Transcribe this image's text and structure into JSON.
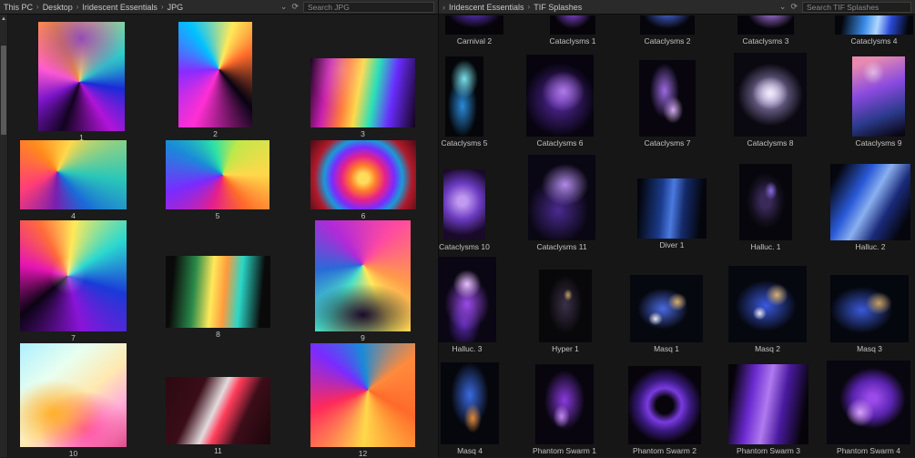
{
  "ui": {
    "crumb_sep": "›",
    "lead_chevron": "›",
    "chevron_down": "⌄",
    "refresh": "⟳",
    "scroll_up": "▲"
  },
  "left_panel": {
    "breadcrumb": [
      "This PC",
      "Desktop",
      "Iridescent Essentials",
      "JPG"
    ],
    "search_placeholder": "Search JPG",
    "items": [
      {
        "label": "1",
        "style": "background-color:#0b0414;background-image:radial-gradient(90% 70% at 50% 15%,rgba(120,40,200,0.8),rgba(0,0,0,0) 60%),conic-gradient(from 200deg at 48% 55%,#12031f,#7a14c8 12%,#ff5ad2 25%,#ff9a2a 38%,#ffe36a 46%,#2ad8c8 60%,#1a2bd8 72%,#b014d8 85%,#12031f)"
      },
      {
        "label": "2",
        "style": "background-color:#070312;background-image:conic-gradient(from 140deg at 55% 45%,#070312,#ff2fd2 18%,#8a2bff 35%,#00c2ff 52%,#ffe95a 66%,#ff6a2a 78%,#070312)"
      },
      {
        "label": "3",
        "style": "background-color:#140318;background-image:radial-gradient(60% 120% at 30% 15%,rgba(255,255,255,0.22),rgba(0,0,0,0) 50%),linear-gradient(100deg,#1a0420,#c81fae 18%,#ff7a3c 34%,#ffd84a 46%,#2ae0b8 60%,#6a2bff 76%,#140318)"
      },
      {
        "label": "4",
        "style": "background-color:#200408;background-image:conic-gradient(from 320deg at 35% 45%,#ff8a1c,#ffd84a 18%,#2ac8b8 38%,#1a6ad8 50%,#7a1fae 62%,#ff3c78 78%,#ff8a1c)"
      },
      {
        "label": "5",
        "style": "background-color:#101010;background-image:conic-gradient(from 90deg at 55% 50%,#ffd84a,#ff6a2a 15%,#e51f8c 30%,#7a2bff 45%,#1a8ad8 58%,#2ae0a8 70%,#bfe84a 82%,#ffd84a)"
      },
      {
        "label": "6",
        "style": "background-color:#1a040a;background-image:radial-gradient(circle at 50% 55%,#ffdc5a 8%,#ff7a2a 20%,#e5208c 34%,#7a2bff 48%,#1a9ad8 60%,#b01a2a 75%,#4a0a14 100%)"
      },
      {
        "label": "7",
        "style": "background-color:#0c0314;background-image:radial-gradient(28% 28% at 45% 50%,rgba(255,255,255,0.3),rgba(0,0,0,0) 60%),conic-gradient(from 230deg at 45% 50%,#0c0314,#e514b4 15%,#ff6a3c 28%,#ffe95a 38%,#2ad8d0 52%,#1a3ad8 66%,#8a14d8 82%,#0c0314)"
      },
      {
        "label": "8",
        "style": "background-color:#0a0a0a;background-image:linear-gradient(95deg,rgba(0,0,0,0) 8%,#2a8a4a 28%,#ffe95a 44%,#ff9a3c 56%,#2ad8c8 70%,rgba(0,0,0,0) 90%)"
      },
      {
        "label": "9",
        "style": "background-color:#140820;background-image:radial-gradient(70% 35% at 50% 85%,#1a0a2a,rgba(0,0,0,0) 80%),conic-gradient(from 40deg at 50% 40%,#ff4aa0,#ff9a4a 20%,#ffe95a 32%,#4ae0c8 48%,#2a6ad8 62%,#b02ad8 78%,#ff4aa0)"
      },
      {
        "label": "10",
        "style": "background-color:#bfeaf0;background-image:radial-gradient(80% 60% at 32% 68%,#ffb02a,rgba(0,0,0,0) 55%),radial-gradient(70% 60% at 60% 82%,#ff4aa0,rgba(0,0,0,0) 60%),linear-gradient(140deg,#aef0ff,#e8fff0 30%,#ffe9b0 55%,#ffb0d8 75%,#e04a8c)"
      },
      {
        "label": "11",
        "style": "background-color:#140a0a;background-image:linear-gradient(115deg,rgba(0,0,0,0) 30%,rgba(255,255,255,0.85) 47%,#ff3c5a 56%,rgba(0,0,0,0) 72%),linear-gradient(115deg,#2a0a10,#4a1020 60%,#1a060a)"
      },
      {
        "label": "12",
        "style": "background-color:#1a060e;background-image:conic-gradient(from 120deg at 55% 45%,#ff6a2a,#ffd84a 18%,#ff2a5a 36%,#7a2bff 52%,#1a8ad8 64%,#ff8a3c 82%,#ff6a2a)"
      }
    ]
  },
  "right_panel": {
    "breadcrumb": [
      "Iridescent Essentials",
      "TIF Splashes"
    ],
    "search_placeholder": "Search TIF Splashes",
    "items": [
      {
        "label": "Carnival 2",
        "style": "background-color:#060409;background-image:radial-gradient(80% 160% at 50% -30%,#6a3ad8,rgba(0,0,0,0) 60%)"
      },
      {
        "label": "Cataclysms 1",
        "style": "background-color:#060409;background-image:radial-gradient(70% 150% at 50% -20%,#8a4ae0,rgba(0,0,0,0) 60%)"
      },
      {
        "label": "Cataclysms 2",
        "style": "background-color:#05050b;background-image:radial-gradient(75% 150% at 50% -20%,#4a6ae0,rgba(0,0,0,0) 60%)"
      },
      {
        "label": "Cataclysms 3",
        "style": "background-color:#06040b;background-image:radial-gradient(70% 150% at 60% -20%,#b07ae8,rgba(0,0,0,0) 60%)"
      },
      {
        "label": "Cataclysms 4",
        "style": "background-color:#04060c;background-image:linear-gradient(100deg,rgba(0,0,0,0) 10%,#3a8ae8 38%,#b0d8ff 54%,#2a4ad8 70%,rgba(0,0,0,0) 92%)"
      },
      {
        "label": "Cataclysms 5",
        "style": "background-color:#04060a;background-image:radial-gradient(60% 40% at 50% 28%,#7ae0e8,rgba(0,0,0,0) 60%),radial-gradient(55% 55% at 45% 62%,#2a8ad8,rgba(0,0,0,0) 70%)"
      },
      {
        "label": "Cataclysms 6",
        "style": "background-color:#070410;background-image:radial-gradient(45% 35% at 55% 45%,#b07ae8,rgba(0,0,0,0) 70%),radial-gradient(70% 60% at 50% 55%,#5a2aa8,rgba(0,0,0,0) 75%)"
      },
      {
        "label": "Cataclysms 7",
        "style": "background-color:#08050e;background-image:radial-gradient(40% 55% at 45% 40%,#9a6ae0,rgba(0,0,0,0) 65%),radial-gradient(30% 30% at 60% 65%,#d8b0f0,rgba(0,0,0,0) 60%)"
      },
      {
        "label": "Cataclysms 8",
        "style": "background-color:#0a0810;background-image:radial-gradient(35% 28% at 50% 48%,#eee8f8 5%,rgba(0,0,0,0) 70%),radial-gradient(60% 50% at 50% 50%,#b0a0e0,rgba(0,0,0,0) 75%)"
      },
      {
        "label": "Cataclysms 9",
        "style": "background-color:#0a0614;background-image:radial-gradient(35% 25% at 40% 20%,rgba(255,255,255,0.5),rgba(0,0,0,0) 60%),linear-gradient(160deg,#e88ab0 10%,#8a4ae0 42%,#2a3a8a 72%,#0a0614 96%)"
      },
      {
        "label": "Cataclysms 10",
        "style": "background-color:#060410;background-image:radial-gradient(circle at 45% 45%,#c09af0 10%,#6a3ac0 40%,#1a0a2a 75%)"
      },
      {
        "label": "Cataclysms 11",
        "style": "background-color:#0a0714;background-image:radial-gradient(50% 35% at 55% 35%,#b08ae8,rgba(0,0,0,0) 70%),radial-gradient(60% 50% at 45% 65%,#4a2a90,rgba(0,0,0,0) 75%)"
      },
      {
        "label": "Diver 1",
        "style": "background-color:#04060c;background-image:linear-gradient(95deg,rgba(0,0,0,0) 5%,#1a3a8a 35%,#4a7ae0 50%,#142a6a 66%,rgba(0,0,0,0) 90%)"
      },
      {
        "label": "Halluc. 1",
        "style": "background-color:#07060c;background-image:radial-gradient(20% 20% at 60% 35%,#8a6ae0,rgba(0,0,0,0) 60%),radial-gradient(45% 45% at 50% 48%,#3a2a5a 20%,#14101f 60%,rgba(0,0,0,0) 82%)"
      },
      {
        "label": "Halluc. 2",
        "style": "background-color:#05060e;background-image:linear-gradient(120deg,rgba(0,0,0,0) 10%,#2a5ad8 35%,#8ab0f0 50%,#1a2a7a 68%,rgba(0,0,0,0) 88%)"
      },
      {
        "label": "Halluc. 3",
        "style": "background-color:#0a0614;background-image:radial-gradient(40% 28% at 50% 32%,#e8c0ff,rgba(0,0,0,0) 60%),radial-gradient(55% 45% at 50% 55%,#9a4ae8,rgba(0,0,0,0) 70%),radial-gradient(40% 40% at 45% 78%,#5a2ab0,rgba(0,0,0,0) 70%)"
      },
      {
        "label": "Hyper 1",
        "style": "background-color:#080709;background-image:radial-gradient(14% 14% at 55% 35%,#c0a060,rgba(0,0,0,0) 60%),radial-gradient(42% 52% at 50% 48%,#3a3048,rgba(0,0,0,0) 78%)"
      },
      {
        "label": "Masq 1",
        "style": "background-color:#060810;background-image:radial-gradient(22% 22% at 65% 40%,#d8b070,rgba(0,0,0,0) 60%),radial-gradient(18% 18% at 35% 65%,#e8e8f0,rgba(0,0,0,0) 55%),radial-gradient(48% 42% at 45% 50%,#4a6ae0,rgba(0,0,0,0) 72%)"
      },
      {
        "label": "Masq 2",
        "style": "background-color:#060810;background-image:radial-gradient(24% 24% at 62% 38%,#d8b070,rgba(0,0,0,0) 60%),radial-gradient(16% 16% at 40% 62%,#e8e8f0,rgba(0,0,0,0) 55%),radial-gradient(52% 45% at 48% 52%,#3a5ae0,rgba(0,0,0,0) 74%)"
      },
      {
        "label": "Masq 3",
        "style": "background-color:#05070e;background-image:radial-gradient(28% 28% at 62% 42%,#c8a060,rgba(0,0,0,0) 60%),radial-gradient(55% 48% at 40% 52%,#3a5ad8,rgba(0,0,0,0) 72%)"
      },
      {
        "label": "Masq 4",
        "style": "background-color:#06070c;background-image:radial-gradient(25% 30% at 55% 68%,#e08a3a,rgba(0,0,0,0) 60%),radial-gradient(45% 55% at 50% 40%,#3a6ae0,rgba(0,0,0,0) 72%)"
      },
      {
        "label": "Phantom Swarm 1",
        "style": "background-color:#08050e;background-image:radial-gradient(24% 24% at 45% 65%,#c08af0,rgba(0,0,0,0) 60%),radial-gradient(48% 52% at 50% 45%,#8a3ae0,rgba(0,0,0,0) 72%)"
      },
      {
        "label": "Phantom Swarm 2",
        "style": "background-color:#07040c;background-image:radial-gradient(circle at 50% 50%,rgba(0,0,0,0) 16%,#7a3ae0 32%,#3a1a80 48%,rgba(0,0,0,0) 70%)"
      },
      {
        "label": "Phantom Swarm 3",
        "style": "background-color:#06040a;background-image:linear-gradient(100deg,rgba(0,0,0,0) 8%,#6a2ad0 30%,#b07af0 48%,#4a1aa0 66%,rgba(0,0,0,0) 90%)"
      },
      {
        "label": "Phantom Swarm 4",
        "style": "background-color:#08060f;background-image:radial-gradient(28% 28% at 40% 62%,#d8a0f8,rgba(0,0,0,0) 60%),radial-gradient(52% 48% at 55% 45%,#9a4ae8 10%,#5a24b0 45%,rgba(0,0,0,0) 76%)"
      }
    ]
  }
}
